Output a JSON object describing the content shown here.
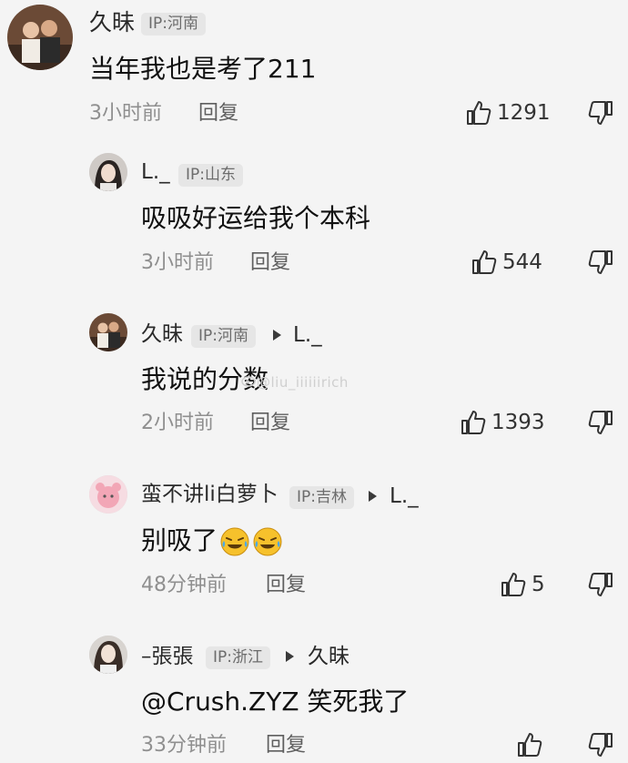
{
  "comments": [
    {
      "name": "久昧",
      "ip": "IP:河南",
      "reply_to": "",
      "text": "当年我也是考了211",
      "time": "3小时前",
      "reply_label": "回复",
      "likes": "1291"
    },
    {
      "name": "L._",
      "ip": "IP:山东",
      "reply_to": "",
      "text": "吸吸好运给我个本科",
      "time": "3小时前",
      "reply_label": "回复",
      "likes": "544"
    },
    {
      "name": "久昧",
      "ip": "IP:河南",
      "reply_to": "L._",
      "text": "我说的分数",
      "time": "2小时前",
      "reply_label": "回复",
      "likes": "1393"
    },
    {
      "name": "蛮不讲li白萝卜",
      "ip": "IP:吉林",
      "reply_to": "L._",
      "text": "别吸了",
      "time": "48分钟前",
      "reply_label": "回复",
      "likes": "5"
    },
    {
      "name": "–張張",
      "ip": "IP:浙江",
      "reply_to": "久昧",
      "text": "@Crush.ZYZ 笑死我了",
      "time": "33分钟前",
      "reply_label": "回复",
      "likes": ""
    }
  ],
  "watermark": "@liu_iiiiiirich",
  "icons": {
    "like": "thumbs-up-icon",
    "dislike": "thumbs-down-icon",
    "reply_arrow": "play-arrow-icon",
    "emoji": "crying-laughing-emoji"
  }
}
